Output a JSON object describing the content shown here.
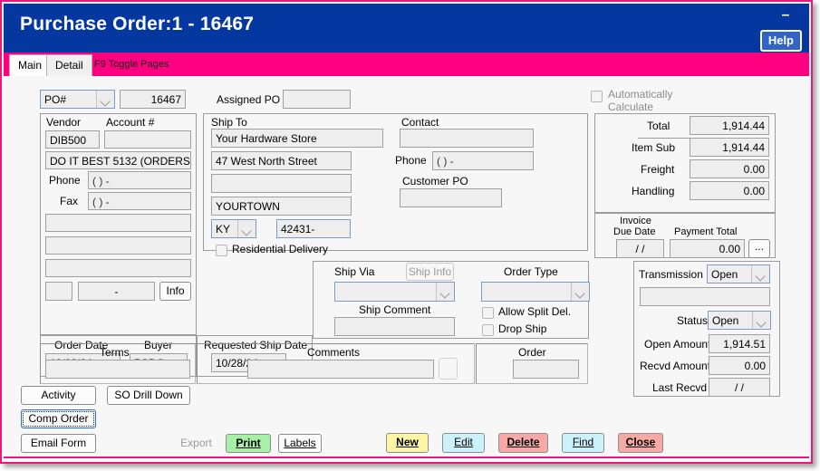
{
  "window": {
    "title": "Purchase Order:1 - 16467",
    "minimize_label": "–",
    "help_label": "Help"
  },
  "tabs": [
    {
      "label": "Main",
      "active": true
    },
    {
      "label": "Detail",
      "active": false
    }
  ],
  "tab_hint": "F9 Toggle Pages",
  "header": {
    "po_type_value": "PO#",
    "po_number": "16467",
    "assigned_po_label": "Assigned PO",
    "assigned_po_value": "",
    "auto_calc_label_line1": "Automatically",
    "auto_calc_label_line2": "Calculate",
    "auto_calc_checked": false
  },
  "vendor": {
    "vendor_label": "Vendor",
    "account_label": "Account #",
    "vendor_code": "DIB500",
    "account_number": "",
    "vendor_name": "DO IT BEST 5132 (ORDERS)",
    "phone_label": "Phone",
    "phone_value": "(  )    -",
    "fax_label": "Fax",
    "fax_value": "(  )    -",
    "addr1": "",
    "addr2": "",
    "addr3": "",
    "state_code": "",
    "zip_value": "-",
    "info_label": "Info"
  },
  "shipto": {
    "group_label": "Ship To",
    "name": "Your Hardware Store",
    "address1": "47 West North Street",
    "address2": "",
    "city": "YOURTOWN",
    "state": "KY",
    "zip": "42431-",
    "residential_label": "Residential Delivery",
    "residential_checked": false
  },
  "contact": {
    "contact_label": "Contact",
    "contact_value": "",
    "phone_label": "Phone",
    "phone_value": "(  )    -",
    "customer_po_label": "Customer PO",
    "customer_po_value": ""
  },
  "totals": {
    "total_label": "Total",
    "total_value": "1,914.44",
    "item_sub_label": "Item Sub",
    "item_sub_value": "1,914.44",
    "freight_label": "Freight",
    "freight_value": "0.00",
    "handling_label": "Handling",
    "handling_value": "0.00",
    "invoice_due_label_line1": "Invoice",
    "invoice_due_label_line2": "Due Date",
    "invoice_due_value": "/  /",
    "payment_total_label": "Payment Total",
    "payment_total_value": "0.00",
    "ellipsis_label": "..."
  },
  "dates": {
    "order_date_label": "Order Date",
    "order_date_value": "10/28/24",
    "buyer_label": "Buyer",
    "buyer_value": "PSDG",
    "requested_ship_label": "Requested Ship Date",
    "requested_ship_value": "10/28/24"
  },
  "shipping": {
    "ship_via_label": "Ship Via",
    "ship_info_label": "Ship Info",
    "ship_via_value": "",
    "ship_comment_label": "Ship Comment",
    "ship_comment_value": "",
    "order_type_label": "Order Type",
    "order_type_value": "",
    "allow_split_label": "Allow Split Del.",
    "allow_split_checked": false,
    "drop_ship_label": "Drop Ship",
    "drop_ship_checked": false
  },
  "transmission": {
    "transmission_label": "Transmission",
    "transmission_value": "Open",
    "transmission_note": "",
    "status_label": "Status",
    "status_value": "Open",
    "open_amount_label": "Open Amount",
    "open_amount_value": "1,914.51",
    "recvd_amount_label": "Recvd Amount",
    "recvd_amount_value": "0.00",
    "last_recvd_label": "Last Recvd",
    "last_recvd_value": "/  /"
  },
  "footer_fields": {
    "terms_label": "Terms",
    "terms_value": "",
    "comments_label": "Comments",
    "comments_value": "",
    "order_label": "Order",
    "order_value": ""
  },
  "action_buttons": {
    "activity": "Activity",
    "so_drill_down": "SO Drill Down",
    "comp_order": "Comp Order",
    "email_form": "Email Form",
    "export": "Export",
    "print": "Print",
    "labels": "Labels"
  },
  "command_buttons": [
    {
      "label": "New",
      "color": "#fdf7a5"
    },
    {
      "label": "Edit",
      "color": "#ccf2fb"
    },
    {
      "label": "Delete",
      "color": "#f7a9a5"
    },
    {
      "label": "Find",
      "color": "#ccf2fb"
    },
    {
      "label": "Close",
      "color": "#f7a9a5"
    }
  ],
  "colors": {
    "titlebar": "#0437a0",
    "tabstrip_pink": "#ff0080",
    "window_border": "#e8197d",
    "help_button": "#3264c8"
  }
}
